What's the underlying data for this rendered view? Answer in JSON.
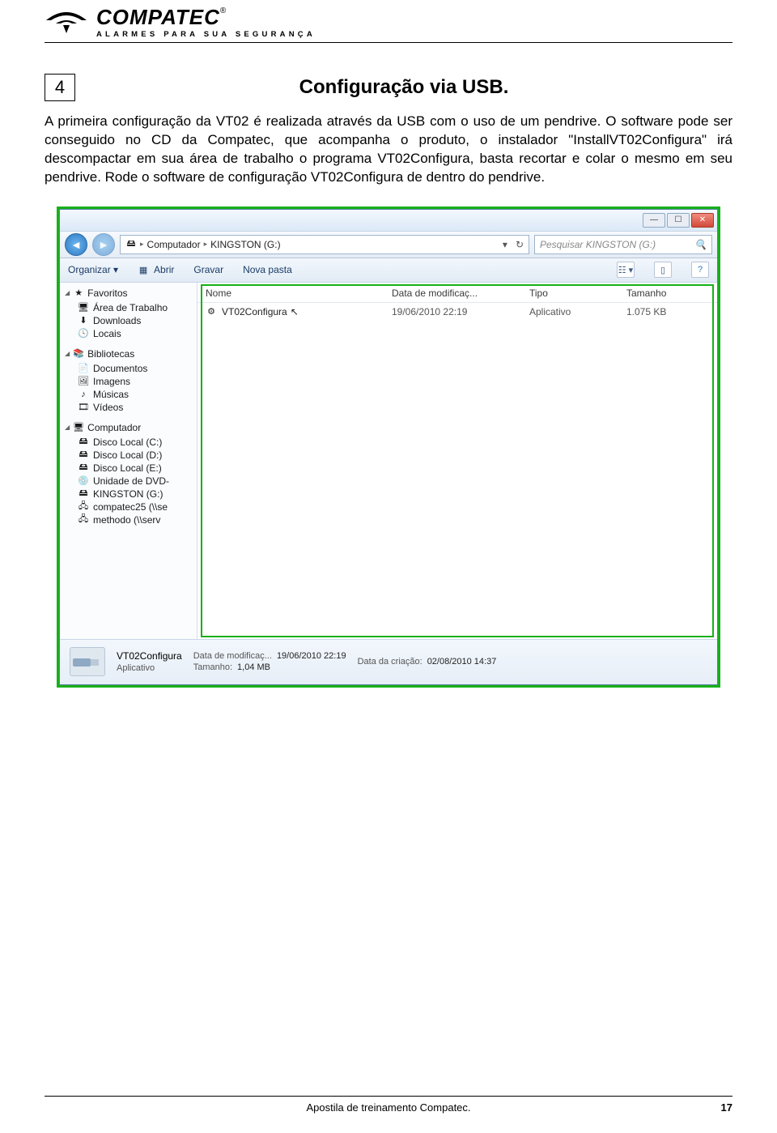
{
  "logo": {
    "title": "COMPATEC",
    "reg": "®",
    "subtitle": "ALARMES PARA SUA SEGURANÇA"
  },
  "section": {
    "number": "4",
    "title": "Configuração via USB."
  },
  "body_text": "A primeira configuração da VT02 é realizada através da USB com o uso de um pendrive. O software pode ser conseguido no CD da Compatec, que acompanha o produto, o instalador \"InstallVT02Configura\" irá descompactar em sua área de trabalho o programa VT02Configura, basta recortar e colar o mesmo em seu pendrive. Rode o software de configuração VT02Configura de dentro do pendrive.",
  "explorer": {
    "breadcrumb": {
      "root": "Computador",
      "drive": "KINGSTON (G:)"
    },
    "search_placeholder": "Pesquisar KINGSTON (G:)",
    "commands": {
      "organize": "Organizar ▾",
      "open": "Abrir",
      "burn": "Gravar",
      "newfolder": "Nova pasta"
    },
    "columns": {
      "name": "Nome",
      "date": "Data de modificaç...",
      "type": "Tipo",
      "size": "Tamanho"
    },
    "file": {
      "name": "VT02Configura",
      "date": "19/06/2010 22:19",
      "type": "Aplicativo",
      "size": "1.075 KB"
    },
    "sidebar": {
      "favorites": {
        "label": "Favoritos",
        "items": [
          "Área de Trabalho",
          "Downloads",
          "Locais"
        ]
      },
      "libraries": {
        "label": "Bibliotecas",
        "items": [
          "Documentos",
          "Imagens",
          "Músicas",
          "Vídeos"
        ]
      },
      "computer": {
        "label": "Computador",
        "items": [
          "Disco Local (C:)",
          "Disco Local (D:)",
          "Disco Local (E:)",
          "Unidade de DVD-",
          "KINGSTON (G:)",
          "compatec25 (\\\\se",
          "methodo (\\\\serv"
        ]
      }
    },
    "details": {
      "title": "VT02Configura",
      "subtitle": "Aplicativo",
      "mod_label": "Data de modificaç...",
      "mod_value": "19/06/2010 22:19",
      "size_label": "Tamanho:",
      "size_value": "1,04 MB",
      "created_label": "Data da criação:",
      "created_value": "02/08/2010 14:37"
    }
  },
  "footer": {
    "text": "Apostila de treinamento Compatec.",
    "page": "17"
  }
}
